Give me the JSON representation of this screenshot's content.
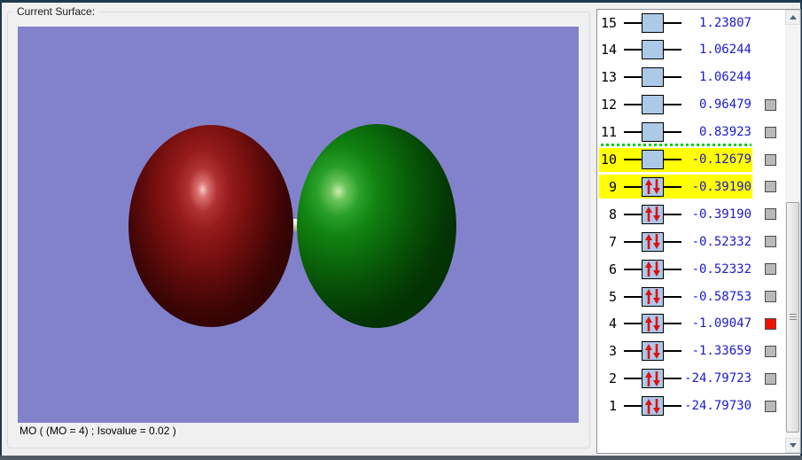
{
  "window": {
    "group_label": "Current Surface:",
    "status_text": "MO ( (MO = 4) ; Isovalue = 0.02 )"
  },
  "viewport": {
    "background_color": "#8282cc",
    "lobe_negative_color": "#8b1414",
    "lobe_positive_color": "#0f7a0f"
  },
  "orbital_list": {
    "value_color": "#1a1acc",
    "highlight_color": "#ffff00",
    "separator_color": "#00cc00",
    "selected_checkbox_color": "#ee1100",
    "separator_above_index": "10",
    "rows": [
      {
        "index": "15",
        "energy": "1.23807",
        "occupied": false,
        "checkbox": "none",
        "highlighted": false
      },
      {
        "index": "14",
        "energy": "1.06244",
        "occupied": false,
        "checkbox": "none",
        "highlighted": false
      },
      {
        "index": "13",
        "energy": "1.06244",
        "occupied": false,
        "checkbox": "none",
        "highlighted": false
      },
      {
        "index": "12",
        "energy": "0.96479",
        "occupied": false,
        "checkbox": "gray",
        "highlighted": false
      },
      {
        "index": "11",
        "energy": "0.83923",
        "occupied": false,
        "checkbox": "gray",
        "highlighted": false
      },
      {
        "index": "10",
        "energy": "-0.12679",
        "occupied": false,
        "checkbox": "gray",
        "highlighted": true
      },
      {
        "index": "9",
        "energy": "-0.39190",
        "occupied": true,
        "checkbox": "gray",
        "highlighted": true
      },
      {
        "index": "8",
        "energy": "-0.39190",
        "occupied": true,
        "checkbox": "gray",
        "highlighted": false
      },
      {
        "index": "7",
        "energy": "-0.52332",
        "occupied": true,
        "checkbox": "gray",
        "highlighted": false
      },
      {
        "index": "6",
        "energy": "-0.52332",
        "occupied": true,
        "checkbox": "gray",
        "highlighted": false
      },
      {
        "index": "5",
        "energy": "-0.58753",
        "occupied": true,
        "checkbox": "gray",
        "highlighted": false
      },
      {
        "index": "4",
        "energy": "-1.09047",
        "occupied": true,
        "checkbox": "red",
        "highlighted": false
      },
      {
        "index": "3",
        "energy": "-1.33659",
        "occupied": true,
        "checkbox": "gray",
        "highlighted": false
      },
      {
        "index": "2",
        "energy": "-24.79723",
        "occupied": true,
        "checkbox": "gray",
        "highlighted": false
      },
      {
        "index": "1",
        "energy": "-24.79730",
        "occupied": true,
        "checkbox": "gray",
        "highlighted": false
      }
    ]
  }
}
